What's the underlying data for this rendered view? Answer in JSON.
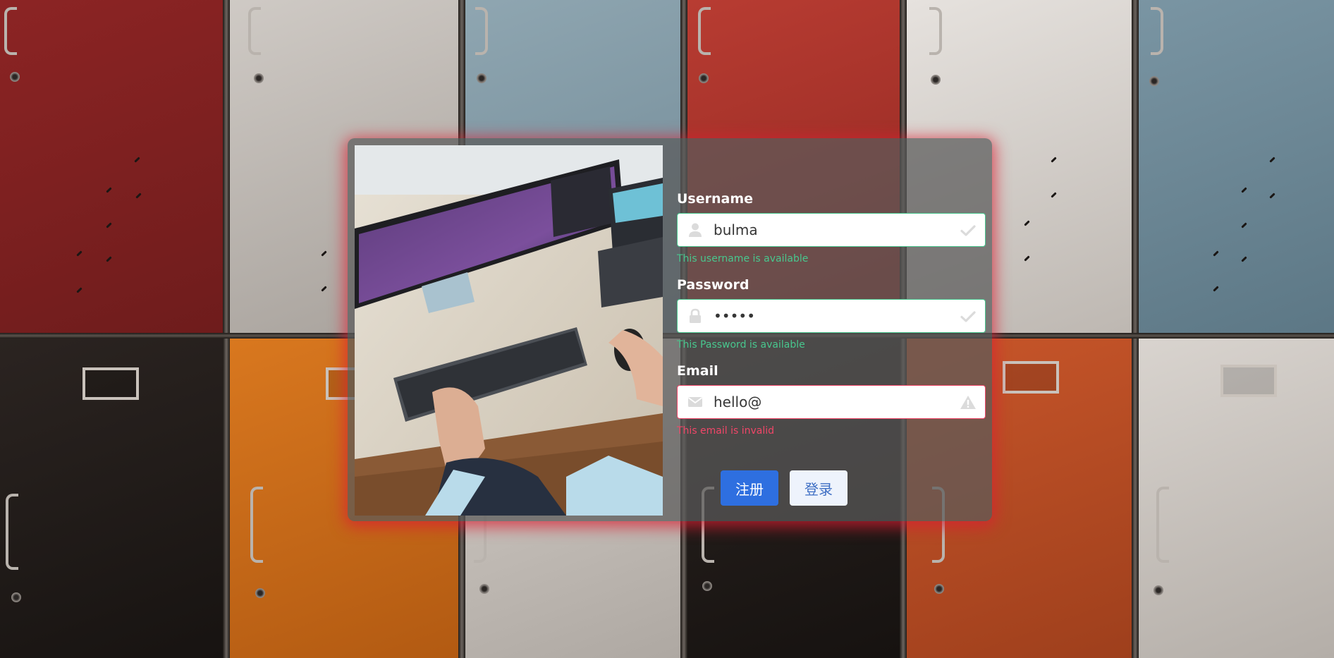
{
  "form": {
    "username": {
      "label": "Username",
      "value": "bulma",
      "help": "This username is available",
      "left_icon": "user-icon",
      "right_icon": "check-icon"
    },
    "password": {
      "label": "Password",
      "value": "•••••",
      "help": "This Password is available",
      "left_icon": "lock-icon",
      "right_icon": "check-icon"
    },
    "email": {
      "label": "Email",
      "value": "hello@",
      "help": "This email is invalid",
      "left_icon": "envelope-icon",
      "right_icon": "warning-icon"
    }
  },
  "buttons": {
    "register_label": "注册",
    "login_label": "登录"
  },
  "colors": {
    "success": "#48c78e",
    "danger": "#f14668",
    "primary": "#2e6fe0",
    "card_glow": "#dc1e32"
  }
}
